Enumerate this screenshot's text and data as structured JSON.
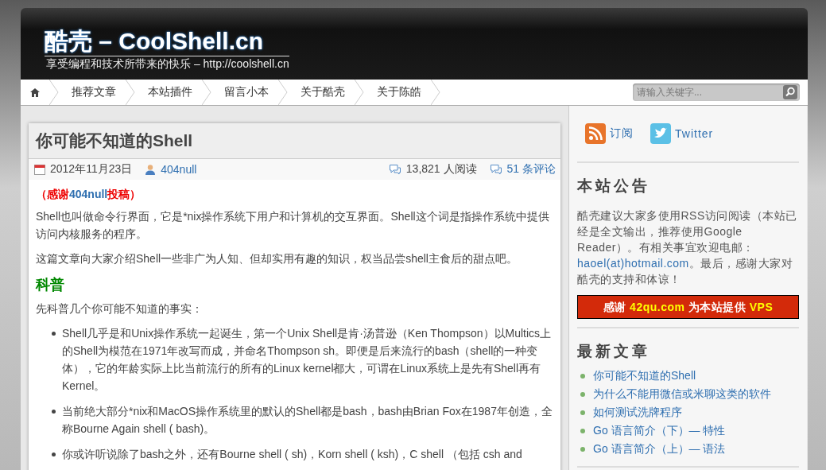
{
  "header": {
    "title": "酷壳 – CoolShell.cn",
    "tagline": "享受编程和技术所带来的快乐 – http://coolshell.cn"
  },
  "nav": {
    "items": [
      {
        "label": "推荐文章"
      },
      {
        "label": "本站插件"
      },
      {
        "label": "留言小本"
      },
      {
        "label": "关于酷壳"
      },
      {
        "label": "关于陈皓"
      }
    ],
    "search": {
      "placeholder": "请输入关键字..."
    }
  },
  "article": {
    "title": "你可能不知道的Shell",
    "date": "2012年11月23日",
    "author": "404null",
    "views": "13,821 人阅读",
    "comments": "51 条评论",
    "thanks": [
      {
        "kind": "plain",
        "text": "（感谢"
      },
      {
        "kind": "link",
        "text": "404null"
      },
      {
        "kind": "plain",
        "text": "投稿）"
      }
    ],
    "paragraphs": [
      "Shell也叫做命令行界面，它是*nix操作系统下用户和计算机的交互界面。Shell这个词是指操作系统中提供访问内核服务的程序。",
      "这篇文章向大家介绍Shell一些非广为人知、但却实用有趣的知识，权当品尝shell主食后的甜点吧。"
    ],
    "section_heading": "科普",
    "intro": "先科普几个你可能不知道的事实：",
    "bullets": [
      "Shell几乎是和Unix操作系统一起诞生，第一个Unix Shell是肯·汤普逊（Ken Thompson）以Multics上的Shell为模范在1971年改写而成，并命名Thompson sh。即便是后来流行的bash（shell的一种变体），它的年龄实际上比当前流行的所有的Linux kernel都大，可谓在Linux系统上是先有Shell再有Kernel。",
      "当前绝大部分*nix和MacOS操作系统里的默认的Shell都是bash，bash由Brian Fox在1987年创造，全称Bourne Again shell ( bash)。",
      "你或许听说除了bash之外，还有Bourne shell ( sh)，Korn shell ( ksh)，C shell （包括 csh and"
    ]
  },
  "sidebar": {
    "subscribe": "订阅",
    "twitter": "Twitter",
    "notice_title": "本站公告",
    "notice": [
      {
        "kind": "plain",
        "text": "酷壳建议大家多使用RSS访问阅读（本站已经是全文输出，推荐使用Google Reader）。有相关事宜欢迎电邮："
      },
      {
        "kind": "link",
        "text": "haoel(at)hotmail.com"
      },
      {
        "kind": "plain",
        "text": "。最后，感谢大家对酷壳的支持和体谅！"
      }
    ],
    "banner": [
      {
        "kind": "plain",
        "text": "感谢 "
      },
      {
        "kind": "highlight",
        "text": "42qu.com"
      },
      {
        "kind": "plain",
        "text": " 为本站提供 "
      },
      {
        "kind": "highlight",
        "text": "VPS"
      }
    ],
    "recent_title": "最新文章",
    "recent": [
      "你可能不知道的Shell",
      "为什么不能用微信或米聊这类的软件",
      "如何测试洗牌程序",
      "Go 语言简介（下）— 特性",
      "Go 语言简介（上）— 语法"
    ]
  }
}
